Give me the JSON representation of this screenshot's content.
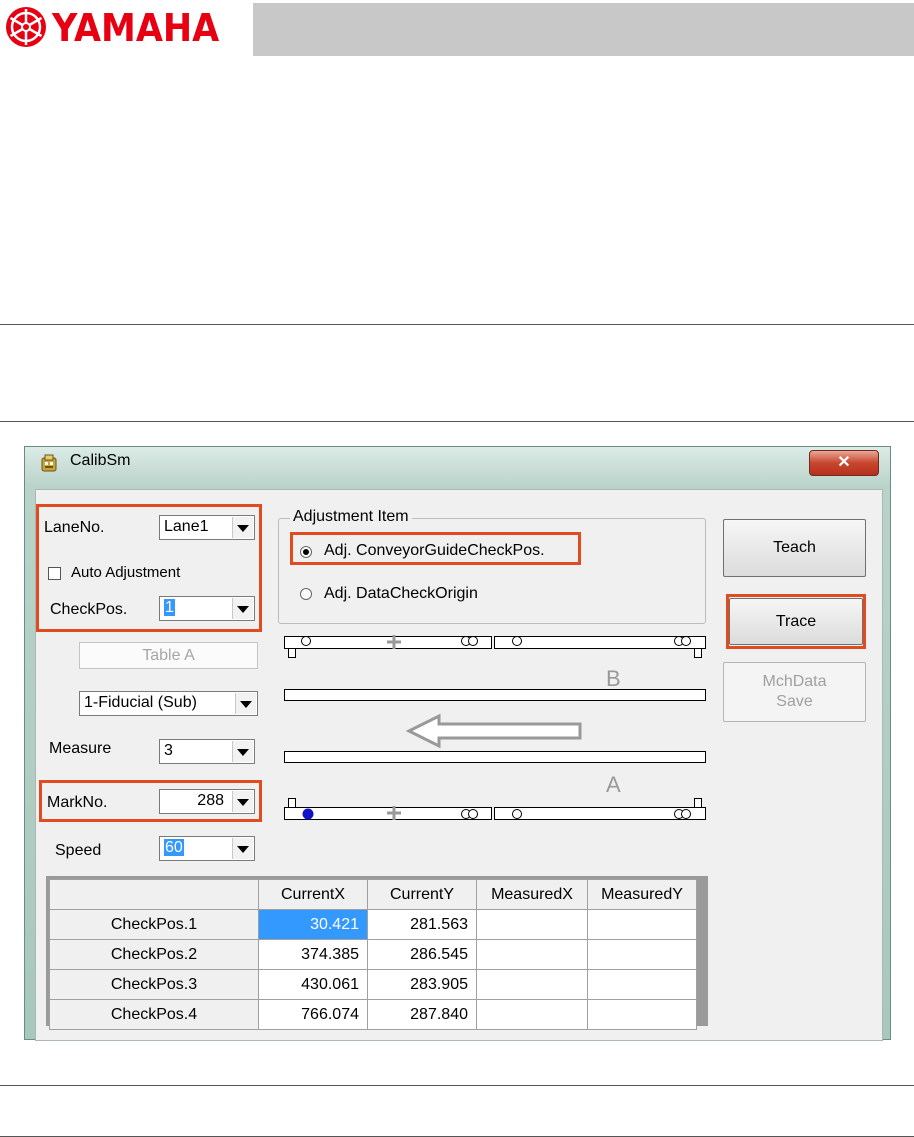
{
  "header": {
    "brand": "YAMAHA"
  },
  "window": {
    "title": "CalibSm",
    "close_glyph": "✕",
    "lane_label": "LaneNo.",
    "lane_value": "Lane1",
    "auto_adjust_label": "Auto Adjustment",
    "checkpos_label": "CheckPos.",
    "checkpos_value": "1",
    "table_field": "Table A",
    "fiducial_value": "1-Fiducial (Sub)",
    "measure_label": "Measure",
    "measure_value": "3",
    "markno_label": "MarkNo.",
    "markno_value": "288",
    "speed_label": "Speed",
    "speed_value": "60",
    "adjustment_group_title": "Adjustment Item",
    "adjustment_options": [
      "Adj. ConveyorGuideCheckPos.",
      "Adj. DataCheckOrigin"
    ],
    "buttons": {
      "teach": "Teach",
      "trace": "Trace",
      "mchdata_line1": "MchData",
      "mchdata_line2": "Save"
    },
    "diagram": {
      "label_b": "B",
      "label_a": "A"
    },
    "grid": {
      "columns": [
        "",
        "CurrentX",
        "CurrentY",
        "MeasuredX",
        "MeasuredY"
      ],
      "rows": [
        {
          "name": "CheckPos.1",
          "cx": "30.421",
          "cy": "281.563",
          "mx": "",
          "my": ""
        },
        {
          "name": "CheckPos.2",
          "cx": "374.385",
          "cy": "286.545",
          "mx": "",
          "my": ""
        },
        {
          "name": "CheckPos.3",
          "cx": "430.061",
          "cy": "283.905",
          "mx": "",
          "my": ""
        },
        {
          "name": "CheckPos.4",
          "cx": "766.074",
          "cy": "287.840",
          "mx": "",
          "my": ""
        }
      ]
    }
  },
  "colors": {
    "brand_red": "#e60012",
    "highlight_box": "#e04c1f",
    "selection": "#3399ff"
  }
}
